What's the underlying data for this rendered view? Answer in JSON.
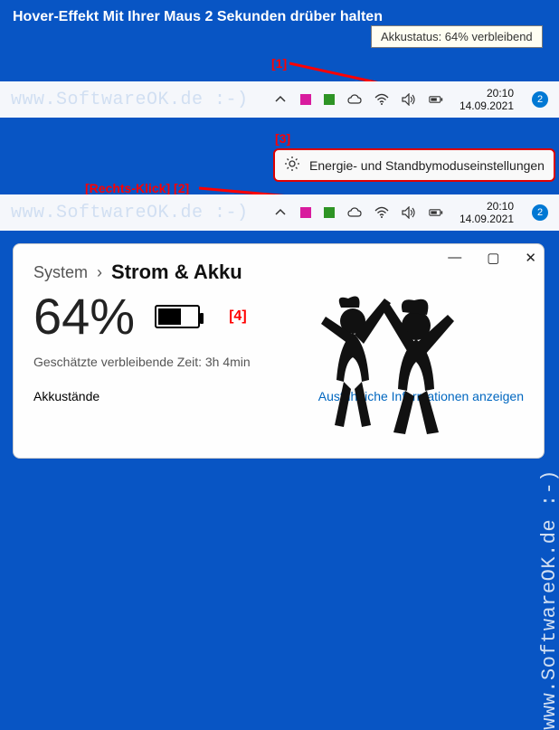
{
  "instruction": "Hover-Effekt Mit Ihrer Maus 2 Sekunden drüber halten",
  "tooltip": "Akkustatus: 64% verbleibend",
  "taskbar": {
    "time": "20:10",
    "date": "14.09.2021",
    "badge": "2",
    "watermark": "www.SoftwareOK.de :-)"
  },
  "context_menu": {
    "label": "Energie- und Standbymoduseinstellungen"
  },
  "annotations": {
    "a1": "[1]",
    "a2_label": "[Rechts-Klick]",
    "a2": "[2]",
    "a3": "[3]",
    "a4": "[4]"
  },
  "panel": {
    "breadcrumb_root": "System",
    "breadcrumb_sep": "›",
    "breadcrumb_current": "Strom & Akku",
    "percent": "64%",
    "estimate_label": "Geschätzte verbleibende Zeit:",
    "estimate_value": "3h 4min",
    "levels_label": "Akkustände",
    "details_link": "Ausführliche Informationen anzeigen"
  },
  "side_watermark": "www.SoftwareOK.de :-)"
}
